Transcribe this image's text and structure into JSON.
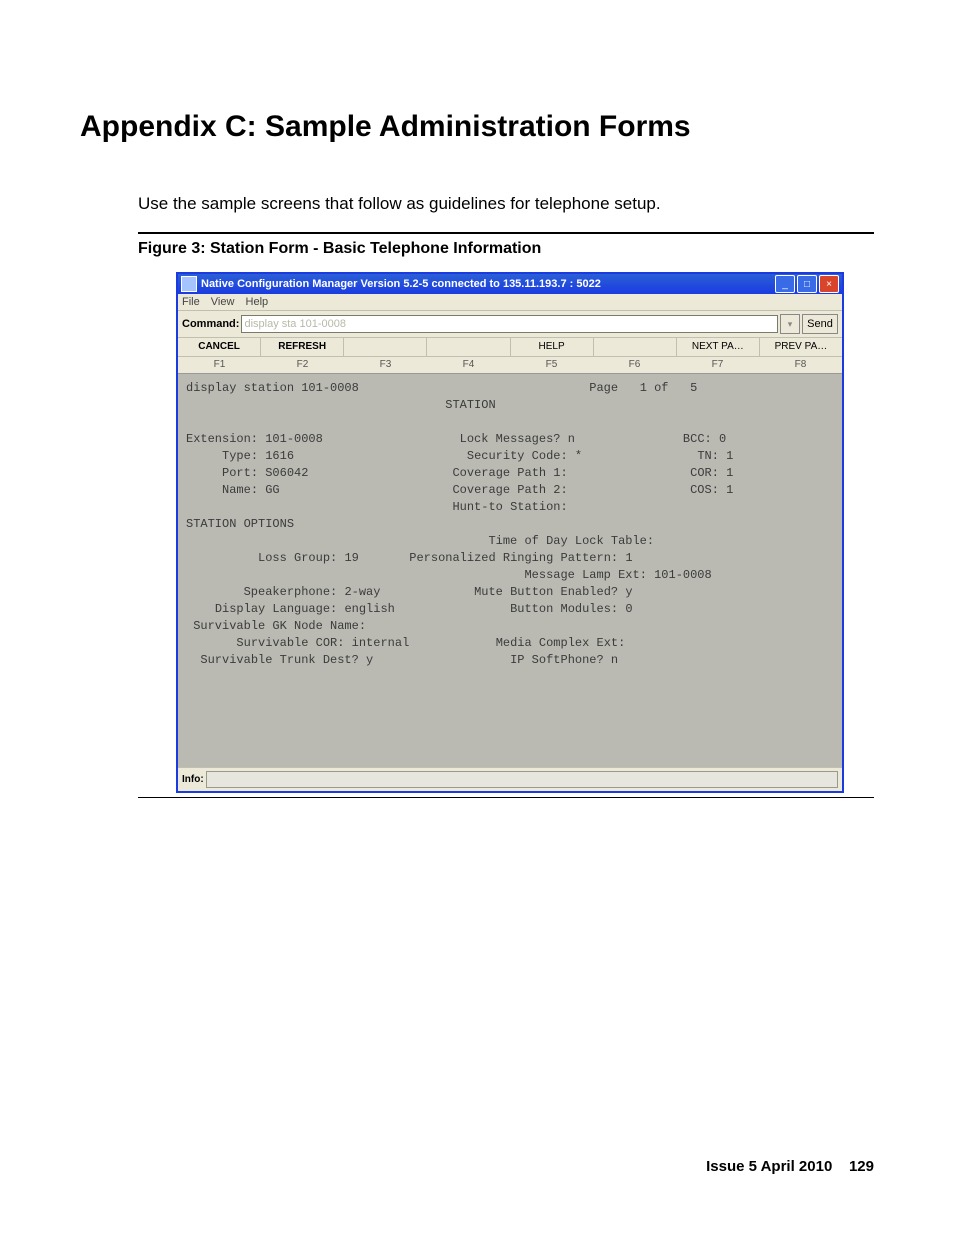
{
  "doc": {
    "heading": "Appendix C: Sample Administration Forms",
    "intro": "Use the sample screens that follow as guidelines for telephone setup.",
    "figcaption": "Figure 3: Station Form - Basic Telephone Information",
    "footer_issue": "Issue 5   April 2010",
    "footer_page": "129"
  },
  "window": {
    "title": "Native Configuration Manager Version 5.2-5 connected to 135.11.193.7 : 5022",
    "menu": {
      "file": "File",
      "view": "View",
      "help": "Help"
    },
    "command_label": "Command:",
    "command_value": "display sta 101-0008",
    "send_label": "Send",
    "buttons": {
      "cancel": "CANCEL",
      "refresh": "REFRESH",
      "help": "HELP",
      "next": "NEXT  PA…",
      "prev": "PREV  PA…"
    },
    "fkeys": {
      "f1": "F1",
      "f2": "F2",
      "f3": "F3",
      "f4": "F4",
      "f5": "F5",
      "f6": "F6",
      "f7": "F7",
      "f8": "F8"
    },
    "info_label": "Info:",
    "winctrl": {
      "min": "_",
      "max": "□",
      "close": "×"
    }
  },
  "terminal": {
    "cmd": "display station 101-0008",
    "page_label": "Page",
    "page_cur": "1",
    "page_of": "of",
    "page_total": "5",
    "title": "STATION",
    "extension": {
      "label": "Extension:",
      "value": "101-0008"
    },
    "type": {
      "label": "Type:",
      "value": "1616"
    },
    "port": {
      "label": "Port:",
      "value": "S06042"
    },
    "name": {
      "label": "Name:",
      "value": "GG"
    },
    "lock": {
      "label": "Lock Messages?",
      "value": "n"
    },
    "sec": {
      "label": "Security Code:",
      "value": "*"
    },
    "cov1": {
      "label": "Coverage Path 1:",
      "value": ""
    },
    "cov2": {
      "label": "Coverage Path 2:",
      "value": ""
    },
    "hunt": {
      "label": "Hunt-to Station:",
      "value": ""
    },
    "bcc": {
      "label": "BCC:",
      "value": "0"
    },
    "tn": {
      "label": "TN:",
      "value": "1"
    },
    "cor": {
      "label": "COR:",
      "value": "1"
    },
    "cos": {
      "label": "COS:",
      "value": "1"
    },
    "section": "STATION OPTIONS",
    "tod": {
      "label": "Time of Day Lock Table:",
      "value": ""
    },
    "loss": {
      "label": "Loss Group:",
      "value": "19"
    },
    "ring": {
      "label": "Personalized Ringing Pattern:",
      "value": "1"
    },
    "msglamp": {
      "label": "Message Lamp Ext:",
      "value": "101-0008"
    },
    "spk": {
      "label": "Speakerphone:",
      "value": "2-way"
    },
    "mute": {
      "label": "Mute Button Enabled?",
      "value": "y"
    },
    "displang": {
      "label": "Display Language:",
      "value": "english"
    },
    "btnmod": {
      "label": "Button Modules:",
      "value": "0"
    },
    "gk": {
      "label": "Survivable GK Node Name:",
      "value": ""
    },
    "scor": {
      "label": "Survivable COR:",
      "value": "internal"
    },
    "media": {
      "label": "Media Complex Ext:",
      "value": ""
    },
    "trunk": {
      "label": "Survivable Trunk Dest?",
      "value": "y"
    },
    "ipsoft": {
      "label": "IP SoftPhone?",
      "value": "n"
    }
  }
}
